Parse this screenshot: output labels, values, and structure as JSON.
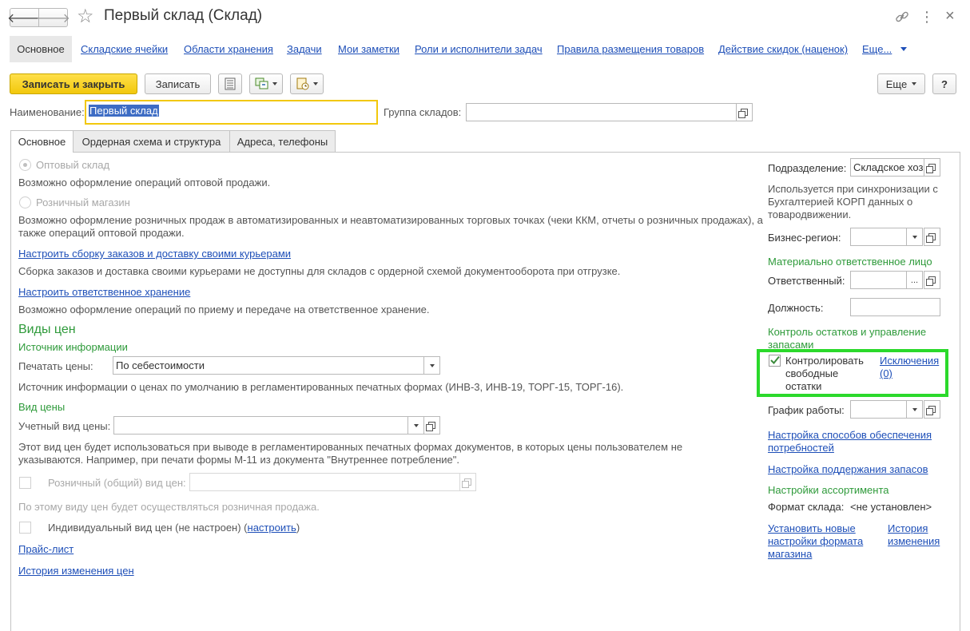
{
  "window": {
    "title": "Первый склад (Склад)"
  },
  "navbar": {
    "items": [
      "Основное",
      "Складские ячейки",
      "Области хранения",
      "Задачи",
      "Мои заметки",
      "Роли и исполнители задач",
      "Правила размещения товаров",
      "Действие скидок (наценок)",
      "Еще..."
    ]
  },
  "toolbar": {
    "save_close": "Записать и закрыть",
    "save": "Записать",
    "more": "Еще",
    "help": "?"
  },
  "header": {
    "name_label": "Наименование:",
    "name_value": "Первый склад",
    "group_label": "Группа складов:",
    "group_value": ""
  },
  "tabs": [
    "Основное",
    "Ордерная схема и структура",
    "Адреса, телефоны"
  ],
  "left": {
    "wholesale_label": "Оптовый склад",
    "wholesale_desc": "Возможно оформление операций оптовой продажи.",
    "retail_label": "Розничный магазин",
    "retail_desc": "Возможно оформление розничных продаж в автоматизированных и неавтоматизированных торговых точках (чеки ККМ, отчеты о розничных продажах), а также операций оптовой продажи.",
    "delivery_link": "Настроить сборку заказов и доставку своими курьерами",
    "delivery_desc": "Сборка заказов и доставка своими курьерами не доступны для складов с ордерной схемой документооборота при отгрузке.",
    "storage_link": "Настроить ответственное хранение",
    "storage_desc": "Возможно оформление операций по приему и передаче на ответственное хранение.",
    "prices_heading": "Виды цен",
    "source_heading": "Источник информации",
    "print_prices_label": "Печатать цены:",
    "print_prices_value": "По себестоимости",
    "source_desc": "Источник информации о ценах по умолчанию в регламентированных печатных формах (ИНВ-3, ИНВ-19, ТОРГ-15, ТОРГ-16).",
    "price_kind_heading": "Вид цены",
    "account_price_label": "Учетный вид цены:",
    "account_price_value": "",
    "account_price_desc": "Этот вид цен будет использоваться при выводе в регламентированных печатных формах документов, в которых цены пользователем не указываются. Например, при печати формы М-11 из документа \"Внутреннее потребление\".",
    "retail_price_label": "Розничный (общий) вид цен:",
    "retail_price_value": "",
    "retail_price_desc": "По этому виду цен будет осуществляться розничная продажа.",
    "individual_price_label": "Индивидуальный вид цен (не настроен) (",
    "individual_price_link": "настроить",
    "individual_price_close": ")",
    "pricelist_link": "Прайс-лист",
    "price_history_link": "История изменения цен"
  },
  "right": {
    "division_label": "Подразделение:",
    "division_value": "Складское хоз",
    "division_desc": "Используется при синхронизации с Бухгалтерией КОРП данных о товародвижении.",
    "region_label": "Бизнес-регион:",
    "region_value": "",
    "mol_heading": "Материально ответственное лицо",
    "responsible_label": "Ответственный:",
    "responsible_value": "",
    "position_label": "Должность:",
    "position_value": "",
    "stock_heading": "Контроль остатков и управление запасами",
    "control_label": "Контролировать свободные остатки",
    "exceptions_link": "Исключения (0)",
    "schedule_label": "График работы:",
    "schedule_value": "",
    "supply_link": "Настройка способов обеспечения потребностей",
    "reserve_link": "Настройка поддержания запасов",
    "assortment_heading": "Настройки ассортимента",
    "format_label": "Формат склада:",
    "format_value": "<не установлен>",
    "new_format_link": "Установить новые настройки формата магазина",
    "history_link": "История изменения"
  },
  "colors": {
    "accent_yellow": "#f5d01c",
    "green_heading": "#2e9a3a",
    "highlight_box": "#2bd92b",
    "link": "#1e4fb8"
  }
}
